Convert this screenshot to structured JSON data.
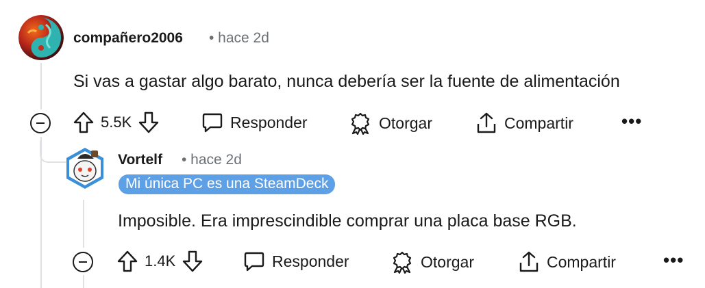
{
  "comments": [
    {
      "username": "compañero2006",
      "time": "• hace 2d",
      "body": "Si vas a gastar algo barato, nunca debería ser la fuente de alimentación",
      "votes": "5.5K",
      "reply_label": "Responder",
      "award_label": "Otorgar",
      "share_label": "Compartir",
      "more_label": "•••"
    },
    {
      "username": "Vortelf",
      "time": "• hace 2d",
      "flair": "Mi única PC es una SteamDeck",
      "body": "Imposible. Era imprescindible comprar una placa base RGB.",
      "votes": "1.4K",
      "reply_label": "Responder",
      "award_label": "Otorgar",
      "share_label": "Compartir",
      "more_label": "•••"
    }
  ],
  "colors": {
    "flair_bg": "#5ea0e6",
    "thread_line": "#dfe1e4",
    "meta_text": "#6b7075"
  },
  "icons": [
    "upvote-icon",
    "downvote-icon",
    "reply-icon",
    "award-icon",
    "share-icon",
    "more-icon",
    "collapse-icon"
  ]
}
